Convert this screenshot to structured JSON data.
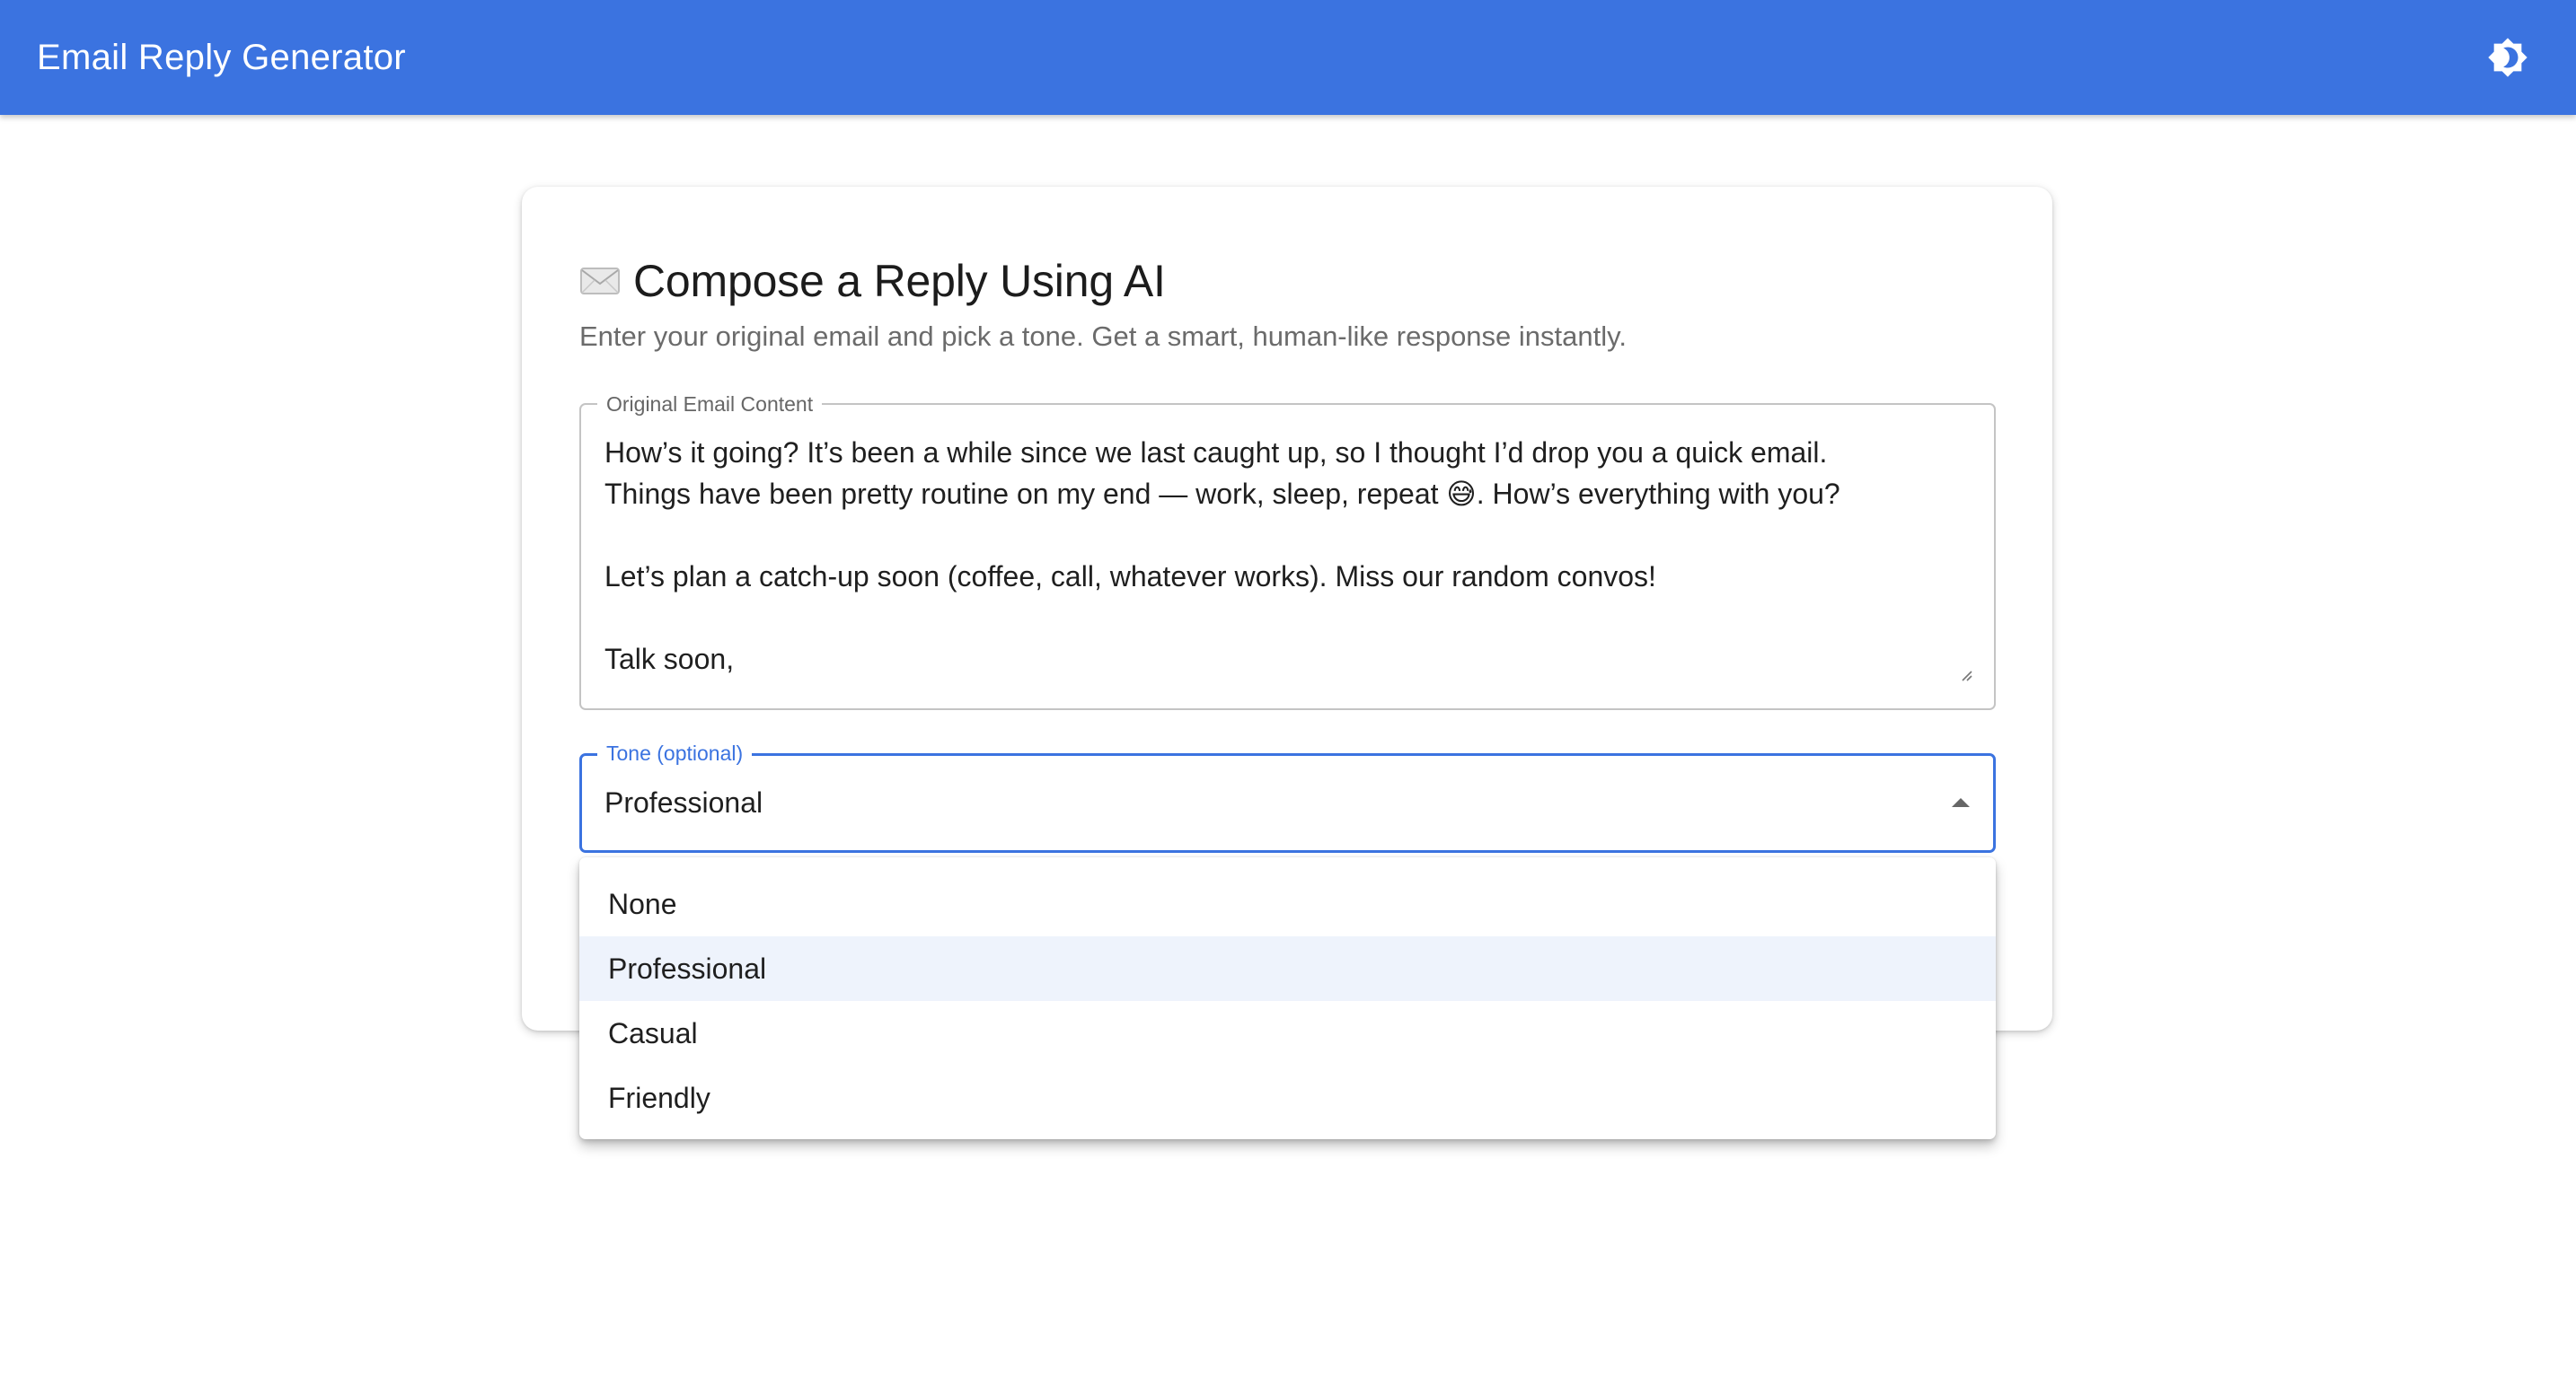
{
  "appbar": {
    "title": "Email Reply Generator",
    "theme_toggle_icon": "brightness-icon"
  },
  "card": {
    "heading_icon": "envelope-icon",
    "heading": "Compose a Reply Using AI",
    "subtitle": "Enter your original email and pick a tone. Get a smart, human-like response instantly."
  },
  "email_field": {
    "label": "Original Email Content",
    "value": "How’s it going? It’s been a while since we last caught up, so I thought I’d drop you a quick email.\nThings have been pretty routine on my end — work, sleep, repeat 😅. How’s everything with you?\n\nLet’s plan a catch-up soon (coffee, call, whatever works). Miss our random convos!\n\nTalk soon,"
  },
  "tone_select": {
    "label": "Tone (optional)",
    "value": "Professional",
    "arrow_icon": "arrow-up-icon",
    "options": [
      "None",
      "Professional",
      "Casual",
      "Friendly"
    ],
    "selected_index": 1
  },
  "colors": {
    "primary": "#3b73e0",
    "selected_option_bg": "#eef3fc"
  }
}
